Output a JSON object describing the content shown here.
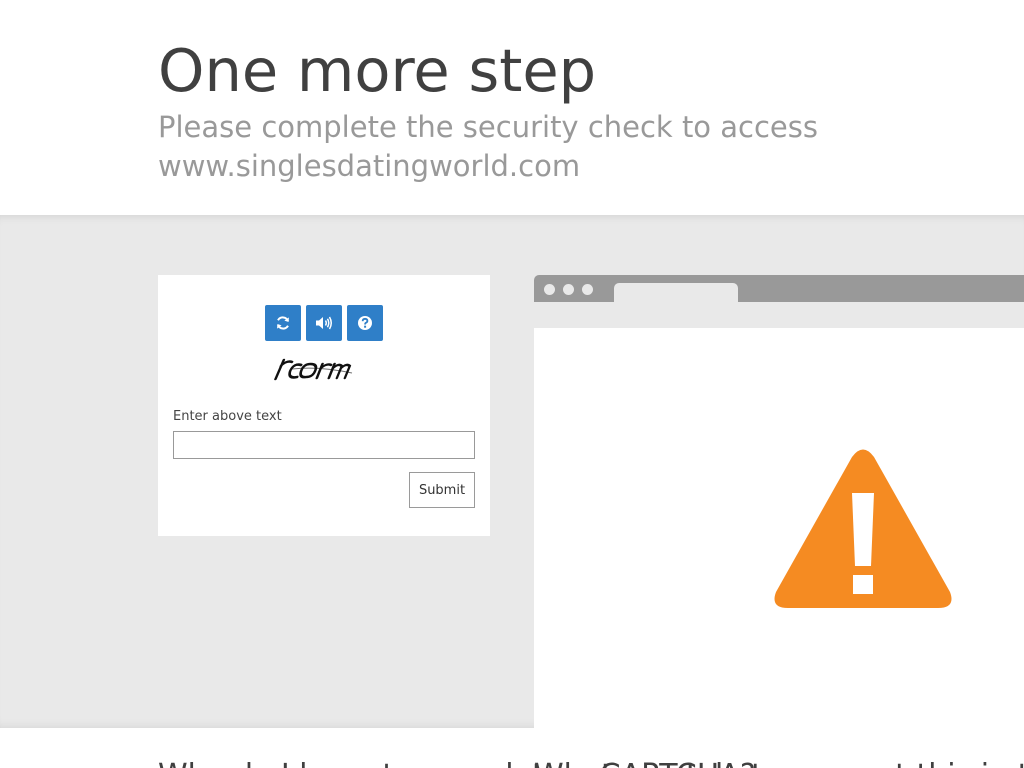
{
  "header": {
    "title": "One more step",
    "subtitle": "Please complete the security check to access www.singlesdatingworld.com"
  },
  "captcha": {
    "buttons": [
      {
        "icon": "refresh-icon"
      },
      {
        "icon": "audio-icon"
      },
      {
        "icon": "help-icon"
      }
    ],
    "button_color": "#2f7fc8",
    "image_text": "rcorm",
    "field_label": "Enter above text",
    "input_value": "",
    "submit_label": "Submit"
  },
  "illustration": {
    "warning_icon": "warning-icon",
    "warning_color": "#f58b22"
  },
  "footer": {
    "headings": [
      "Why do I have to complete a CAPTCHA?",
      "What can I do to prevent this in the future?"
    ]
  }
}
